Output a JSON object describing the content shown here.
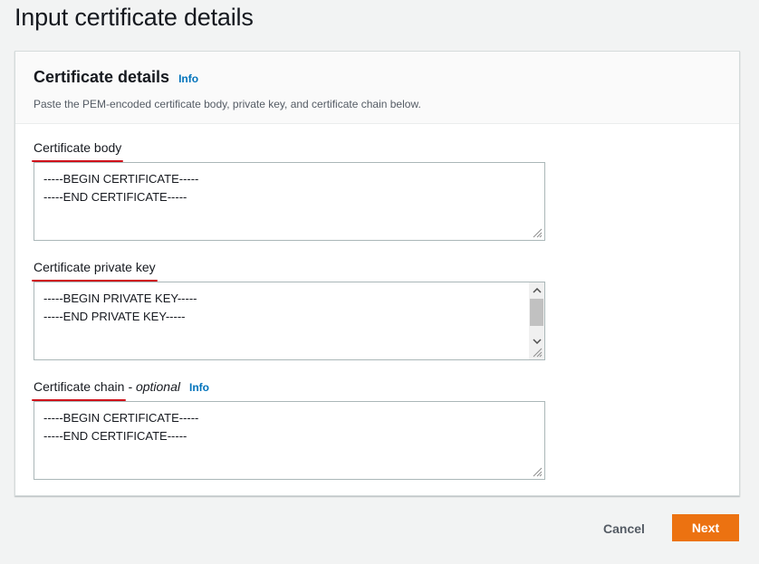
{
  "page": {
    "title": "Input certificate details"
  },
  "panel": {
    "title": "Certificate details",
    "info_label": "Info",
    "description": "Paste the PEM-encoded certificate body, private key, and certificate chain below."
  },
  "fields": {
    "body": {
      "label": "Certificate body",
      "lines": [
        "-----BEGIN CERTIFICATE-----",
        "-----END CERTIFICATE-----"
      ]
    },
    "private_key": {
      "label": "Certificate private key",
      "lines": [
        "-----BEGIN PRIVATE KEY-----",
        "-----END PRIVATE KEY-----"
      ]
    },
    "chain": {
      "label": "Certificate chain",
      "optional_label": "- optional",
      "info_label": "Info",
      "lines": [
        "-----BEGIN CERTIFICATE-----",
        "-----END CERTIFICATE-----"
      ]
    }
  },
  "actions": {
    "cancel_label": "Cancel",
    "next_label": "Next"
  },
  "colors": {
    "primary_button": "#ec7211",
    "link": "#0073bb",
    "annotation_underline": "#d0121b"
  },
  "icons": {
    "resize": "resize-grip-icon",
    "scroll_up": "chevron-up-icon",
    "scroll_down": "chevron-down-icon"
  }
}
